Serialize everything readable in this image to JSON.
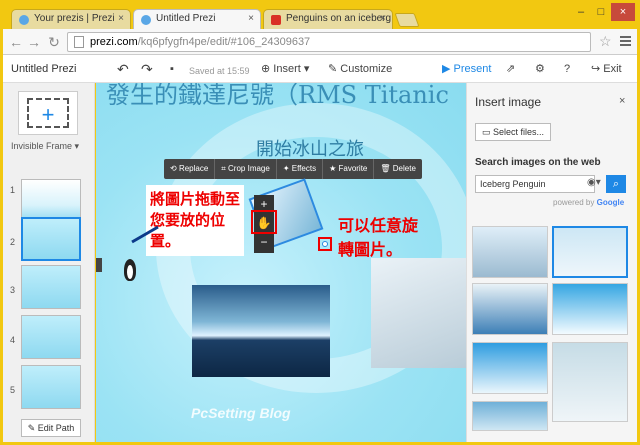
{
  "browser": {
    "tabs": [
      {
        "label": "Your prezis | Prezi",
        "active": false
      },
      {
        "label": "Untitled Prezi",
        "active": true
      },
      {
        "label": "Penguins on an iceberg",
        "active": false
      }
    ],
    "url_host": "prezi.com",
    "url_path": "/kq6pfygfn4pe/edit/#106_24309637"
  },
  "appbar": {
    "title": "Untitled Prezi",
    "saved": "Saved at 15:59",
    "insert": "Insert",
    "customize": "Customize",
    "present": "Present",
    "exit": "Exit"
  },
  "left_panel": {
    "frame_type": "Invisible Frame",
    "thumbs": [
      "1",
      "2",
      "3",
      "4",
      "5"
    ],
    "edit_path": "Edit Path"
  },
  "canvas": {
    "title": "發生的鐵達尼號（RMS Titanic",
    "subtitle": "開始冰山之旅",
    "toolbar": [
      "Replace",
      "Crop Image",
      "Effects",
      "Favorite",
      "Delete"
    ],
    "note1": "將圖片拖動至您要放的位置。",
    "note2": "可以任意旋轉圖片。",
    "watermark": "PcSetting Blog"
  },
  "insert_panel": {
    "title": "Insert image",
    "select_files": "Select files...",
    "search_title": "Search images on the web",
    "search_value": "Iceberg Penguin",
    "powered_by": "powered by",
    "google": "Google"
  }
}
